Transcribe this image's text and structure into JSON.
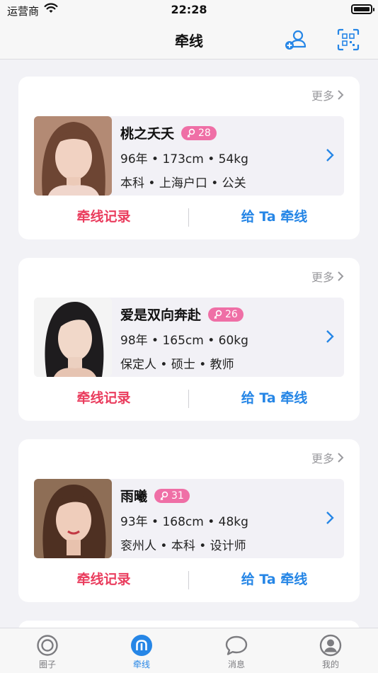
{
  "status_bar": {
    "carrier": "运营商",
    "time": "22:28"
  },
  "nav": {
    "title": "牵线"
  },
  "colors": {
    "accent": "#2686e6",
    "record": "#ea3d5e",
    "badge": "#ef6fa6"
  },
  "cards": [
    {
      "more": "更多",
      "name": "桃之夭夭",
      "badge_count": "28",
      "line1": "96年 • 173cm • 54kg",
      "line2": "本科 • 上海户口 • 公关",
      "record_label": "牵线记录",
      "give_label": "给 Ta 牵线"
    },
    {
      "more": "更多",
      "name": "爱是双向奔赴",
      "badge_count": "26",
      "line1": "98年 • 165cm • 60kg",
      "line2": "保定人 • 硕士 • 教师",
      "record_label": "牵线记录",
      "give_label": "给 Ta 牵线"
    },
    {
      "more": "更多",
      "name": "雨曦",
      "badge_count": "31",
      "line1": "93年 • 168cm • 48kg",
      "line2": "衮州人 • 本科 • 设计师",
      "record_label": "牵线记录",
      "give_label": "给 Ta 牵线"
    }
  ],
  "tabs": [
    {
      "label": "圈子",
      "icon": "circle-icon"
    },
    {
      "label": "牵线",
      "icon": "match-icon",
      "active": true
    },
    {
      "label": "消息",
      "icon": "chat-icon"
    },
    {
      "label": "我的",
      "icon": "profile-icon"
    }
  ]
}
